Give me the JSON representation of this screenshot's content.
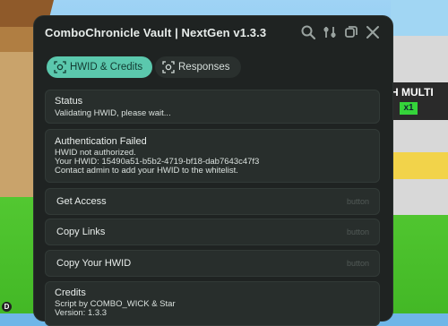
{
  "window": {
    "title": "ComboChronicle Vault | NextGen v1.3.3",
    "icons": [
      "search-icon",
      "settings-toggle-icon",
      "minimize-icon",
      "close-icon"
    ]
  },
  "tabs": [
    {
      "label": "HWID & Credits",
      "active": true,
      "icon": "fingerprint-icon"
    },
    {
      "label": "Responses",
      "active": false,
      "icon": "fingerprint-icon"
    }
  ],
  "status": {
    "title": "Status",
    "text": "Validating HWID, please wait..."
  },
  "auth": {
    "title": "Authentication Failed",
    "lines": [
      "HWID not authorized.",
      "Your HWID: 15490a51-b5b2-4719-bf18-dab7643c47f3",
      "Contact admin to add your HWID to the whitelist."
    ]
  },
  "buttons": [
    {
      "label": "Get Access",
      "hint": "button"
    },
    {
      "label": "Copy Links",
      "hint": "button"
    },
    {
      "label": "Copy Your HWID",
      "hint": "button"
    }
  ],
  "credits": {
    "title": "Credits",
    "lines": [
      "Script by COMBO_WICK & Star",
      "Version: 1.3.3"
    ]
  },
  "game": {
    "sign_text": "H MULTI",
    "sign_badge": "x1",
    "avatar_letter": "D"
  },
  "colors": {
    "panel": "#1f2322",
    "card": "#282e2c",
    "accent": "#5bc8ad"
  }
}
